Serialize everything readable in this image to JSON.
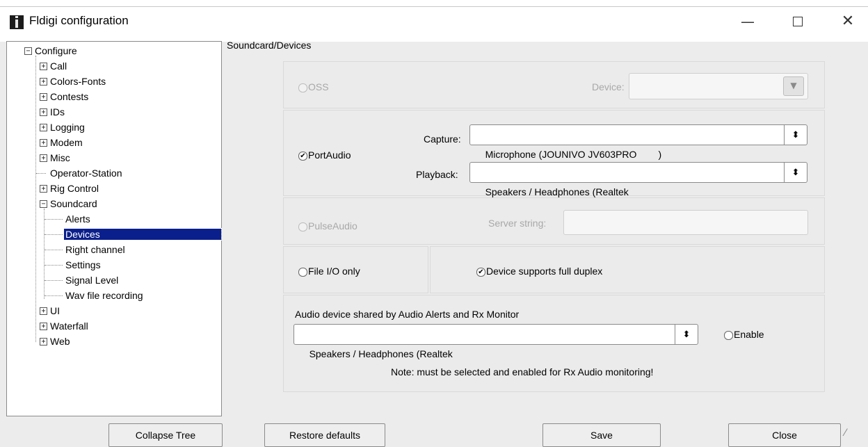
{
  "window": {
    "title": "Fldigi configuration",
    "minimize_symbol": "—",
    "close_symbol": "✕"
  },
  "tree": {
    "root": "Configure",
    "items": [
      {
        "label": "Call",
        "expander": "+"
      },
      {
        "label": "Colors-Fonts",
        "expander": "+"
      },
      {
        "label": "Contests",
        "expander": "+"
      },
      {
        "label": "IDs",
        "expander": "+"
      },
      {
        "label": "Logging",
        "expander": "+"
      },
      {
        "label": "Modem",
        "expander": "+"
      },
      {
        "label": "Misc",
        "expander": "+"
      },
      {
        "label": "Operator-Station"
      },
      {
        "label": "Rig Control",
        "expander": "+"
      },
      {
        "label": "Soundcard",
        "expander": "−"
      },
      {
        "label": "UI",
        "expander": "+"
      },
      {
        "label": "Waterfall",
        "expander": "+"
      },
      {
        "label": "Web",
        "expander": "+"
      }
    ],
    "soundcard_children": [
      "Alerts",
      "Devices",
      "Right channel",
      "Settings",
      "Signal Level",
      "Wav file recording"
    ],
    "selected": "Devices"
  },
  "panel": {
    "section_title": "Soundcard/Devices",
    "oss": {
      "label": "OSS",
      "device_label": "Device:"
    },
    "portaudio": {
      "label": "PortAudio",
      "capture_label": "Capture:",
      "capture_value": "Microphone (JOUNIVO JV603PRO        )",
      "playback_label": "Playback:",
      "playback_value": "Speakers / Headphones (Realtek"
    },
    "pulseaudio": {
      "label": "PulseAudio",
      "server_label": "Server string:"
    },
    "file_io": {
      "label": "File I/O only"
    },
    "full_duplex": {
      "label": "Device supports full duplex"
    },
    "shared": {
      "title": "Audio device shared by Audio Alerts and Rx Monitor",
      "value": "Speakers / Headphones (Realtek",
      "enable_label": "Enable",
      "note": "Note: must be selected and enabled for Rx Audio monitoring!"
    }
  },
  "buttons": {
    "collapse_tree": "Collapse Tree",
    "restore_defaults": "Restore defaults",
    "save": "Save",
    "close": "Close"
  },
  "icons": {
    "check": "✔",
    "updown": "⬍",
    "dropdown": "▼",
    "grip": "⁄"
  }
}
